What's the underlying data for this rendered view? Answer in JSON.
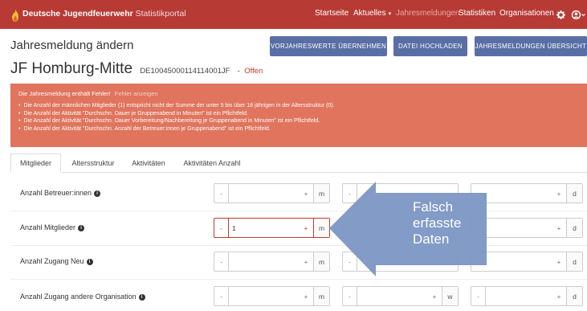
{
  "navbar": {
    "brand_title": "Deutsche Jugendfeuerwehr",
    "brand_sub": "Statistikportal",
    "items": [
      {
        "label": "Startseite",
        "dim": false,
        "caret": false
      },
      {
        "label": "Aktuelles",
        "dim": false,
        "caret": true
      },
      {
        "label": "Jahresmeldungen",
        "dim": true,
        "caret": false
      },
      {
        "label": "Statistiken",
        "dim": false,
        "caret": false
      },
      {
        "label": "Organisationen",
        "dim": false,
        "caret": false
      }
    ],
    "settings_icon": "gear-icon",
    "user_icon": "user-icon"
  },
  "header": {
    "page_title": "Jahresmeldung ändern",
    "org_name": "JF Homburg-Mitte",
    "org_code": "DE10045000114114001JF",
    "separator": "-",
    "status": "Offen",
    "buttons": {
      "prev_year": "VORJAHRESWERTE ÜBERNEHMEN",
      "upload": "DATEI HOCHLADEN",
      "overview": "JAHRESMELDUNGEN ÜBERSICHT"
    }
  },
  "errors": {
    "heading": "Die Jahresmeldung enthält Fehler!",
    "show_link": "Fehler anzeigen",
    "items": [
      "Die Anzahl der männlichen Mitglieder (1) entspricht nicht der Summe der unter 5 bis über 18 jährigen in der Altersstruktur (0).",
      "Die Anzahl der Aktivität \"Durchschn. Dauer je Gruppenabend in Minuten\" ist ein Pflichtfeld.",
      "Die Anzahl der Aktivität \"Durchschn. Dauer Vorbereitung/Nachbereitung je Gruppenabend in Minuten\" ist ein Pflichtfeld.",
      "Die Anzahl der Aktivität \"Durchschn. Anzahl der Betreuer:innen je Gruppenabend\" ist ein Pflichtfeld."
    ]
  },
  "tabs": [
    "Mitglieder",
    "Altersstruktur",
    "Aktivitäten",
    "Aktivitäten Anzahl"
  ],
  "rows": [
    {
      "label": "Anzahl Betreuer:innen",
      "fields": [
        {
          "value": "",
          "unit": "m"
        },
        {
          "value": "",
          "unit": ""
        },
        {
          "value": "",
          "unit": "d"
        }
      ]
    },
    {
      "label": "Anzahl Mitglieder",
      "fields": [
        {
          "value": "1",
          "unit": "m"
        },
        {
          "value": "",
          "unit": ""
        },
        {
          "value": "",
          "unit": "d"
        }
      ]
    },
    {
      "label": "Anzahl Zugang Neu",
      "fields": [
        {
          "value": "",
          "unit": "m"
        },
        {
          "value": "",
          "unit": ""
        },
        {
          "value": "",
          "unit": "d"
        }
      ]
    },
    {
      "label": "Anzahl Zugang andere Organisation",
      "fields": [
        {
          "value": "",
          "unit": "m"
        },
        {
          "value": "",
          "unit": "w"
        },
        {
          "value": "",
          "unit": "d"
        }
      ]
    }
  ],
  "symbols": {
    "minus": "-",
    "plus": "+"
  },
  "annotation": {
    "line1": "Falsch",
    "line2": "erfasste",
    "line3": "Daten",
    "color": "#7b96c4"
  },
  "colors": {
    "navbar": "#b83a35",
    "button": "#5a6ea6",
    "error_box": "#e0745d",
    "error_field": "#c0392b"
  }
}
